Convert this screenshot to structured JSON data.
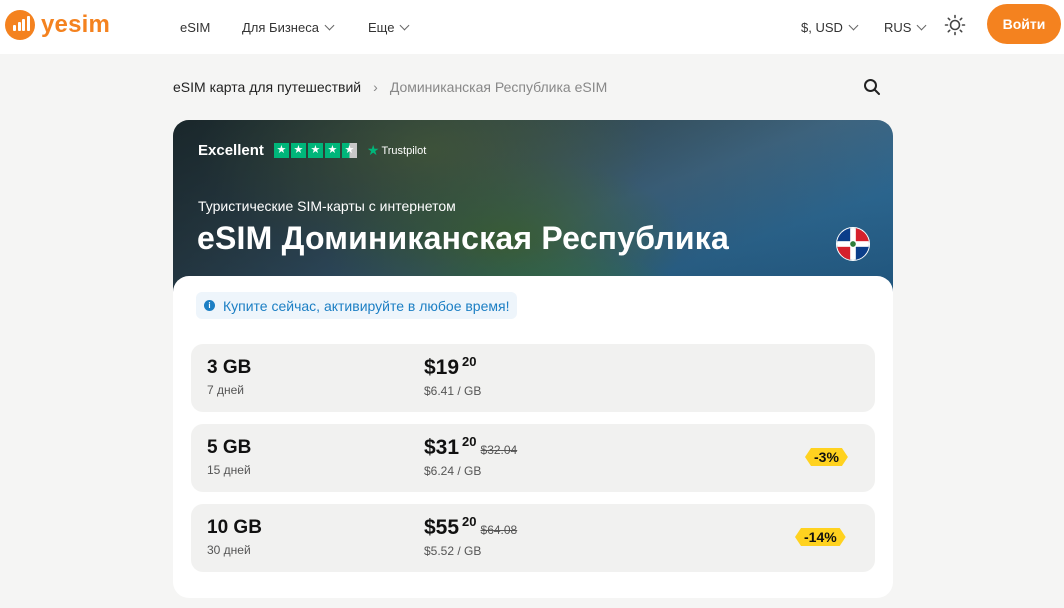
{
  "brand": {
    "name": "yesim",
    "color": "#f4821f"
  },
  "nav": {
    "items": [
      {
        "label": "eSIM",
        "dropdown": false
      },
      {
        "label": "Для Бизнеса",
        "dropdown": true
      },
      {
        "label": "Еще",
        "dropdown": true
      }
    ],
    "currency": "$, USD",
    "language": "RUS",
    "theme_icon": "sun-icon",
    "login_label": "Войти"
  },
  "breadcrumb": {
    "home": "eSIM карта для путешествий",
    "current": "Доминиканская Республика eSIM"
  },
  "hero": {
    "rating_word": "Excellent",
    "rating_stars": 4.5,
    "rating_brand": "Trustpilot",
    "subtitle": "Туристические SIM-карты с интернетом",
    "title": "eSIM Доминиканская Республика",
    "flag_icon": "dominican-republic-flag-icon"
  },
  "info_banner": "Купите сейчас, активируйте в любое время!",
  "plans": [
    {
      "data": "3 GB",
      "duration": "7 дней",
      "price_main": "$19",
      "price_cents": "20",
      "old_price": "",
      "per_gb": "$6.41 / GB",
      "discount": ""
    },
    {
      "data": "5 GB",
      "duration": "15 дней",
      "price_main": "$31",
      "price_cents": "20",
      "old_price": "$32.04",
      "per_gb": "$6.24 / GB",
      "discount": "-3%"
    },
    {
      "data": "10 GB",
      "duration": "30 дней",
      "price_main": "$55",
      "price_cents": "20",
      "old_price": "$64.08",
      "per_gb": "$5.52 / GB",
      "discount": "-14%"
    }
  ],
  "colors": {
    "accent": "#f4821f",
    "info_text": "#1c7fc4",
    "badge": "#ffd21f",
    "trustpilot": "#00b67a"
  }
}
